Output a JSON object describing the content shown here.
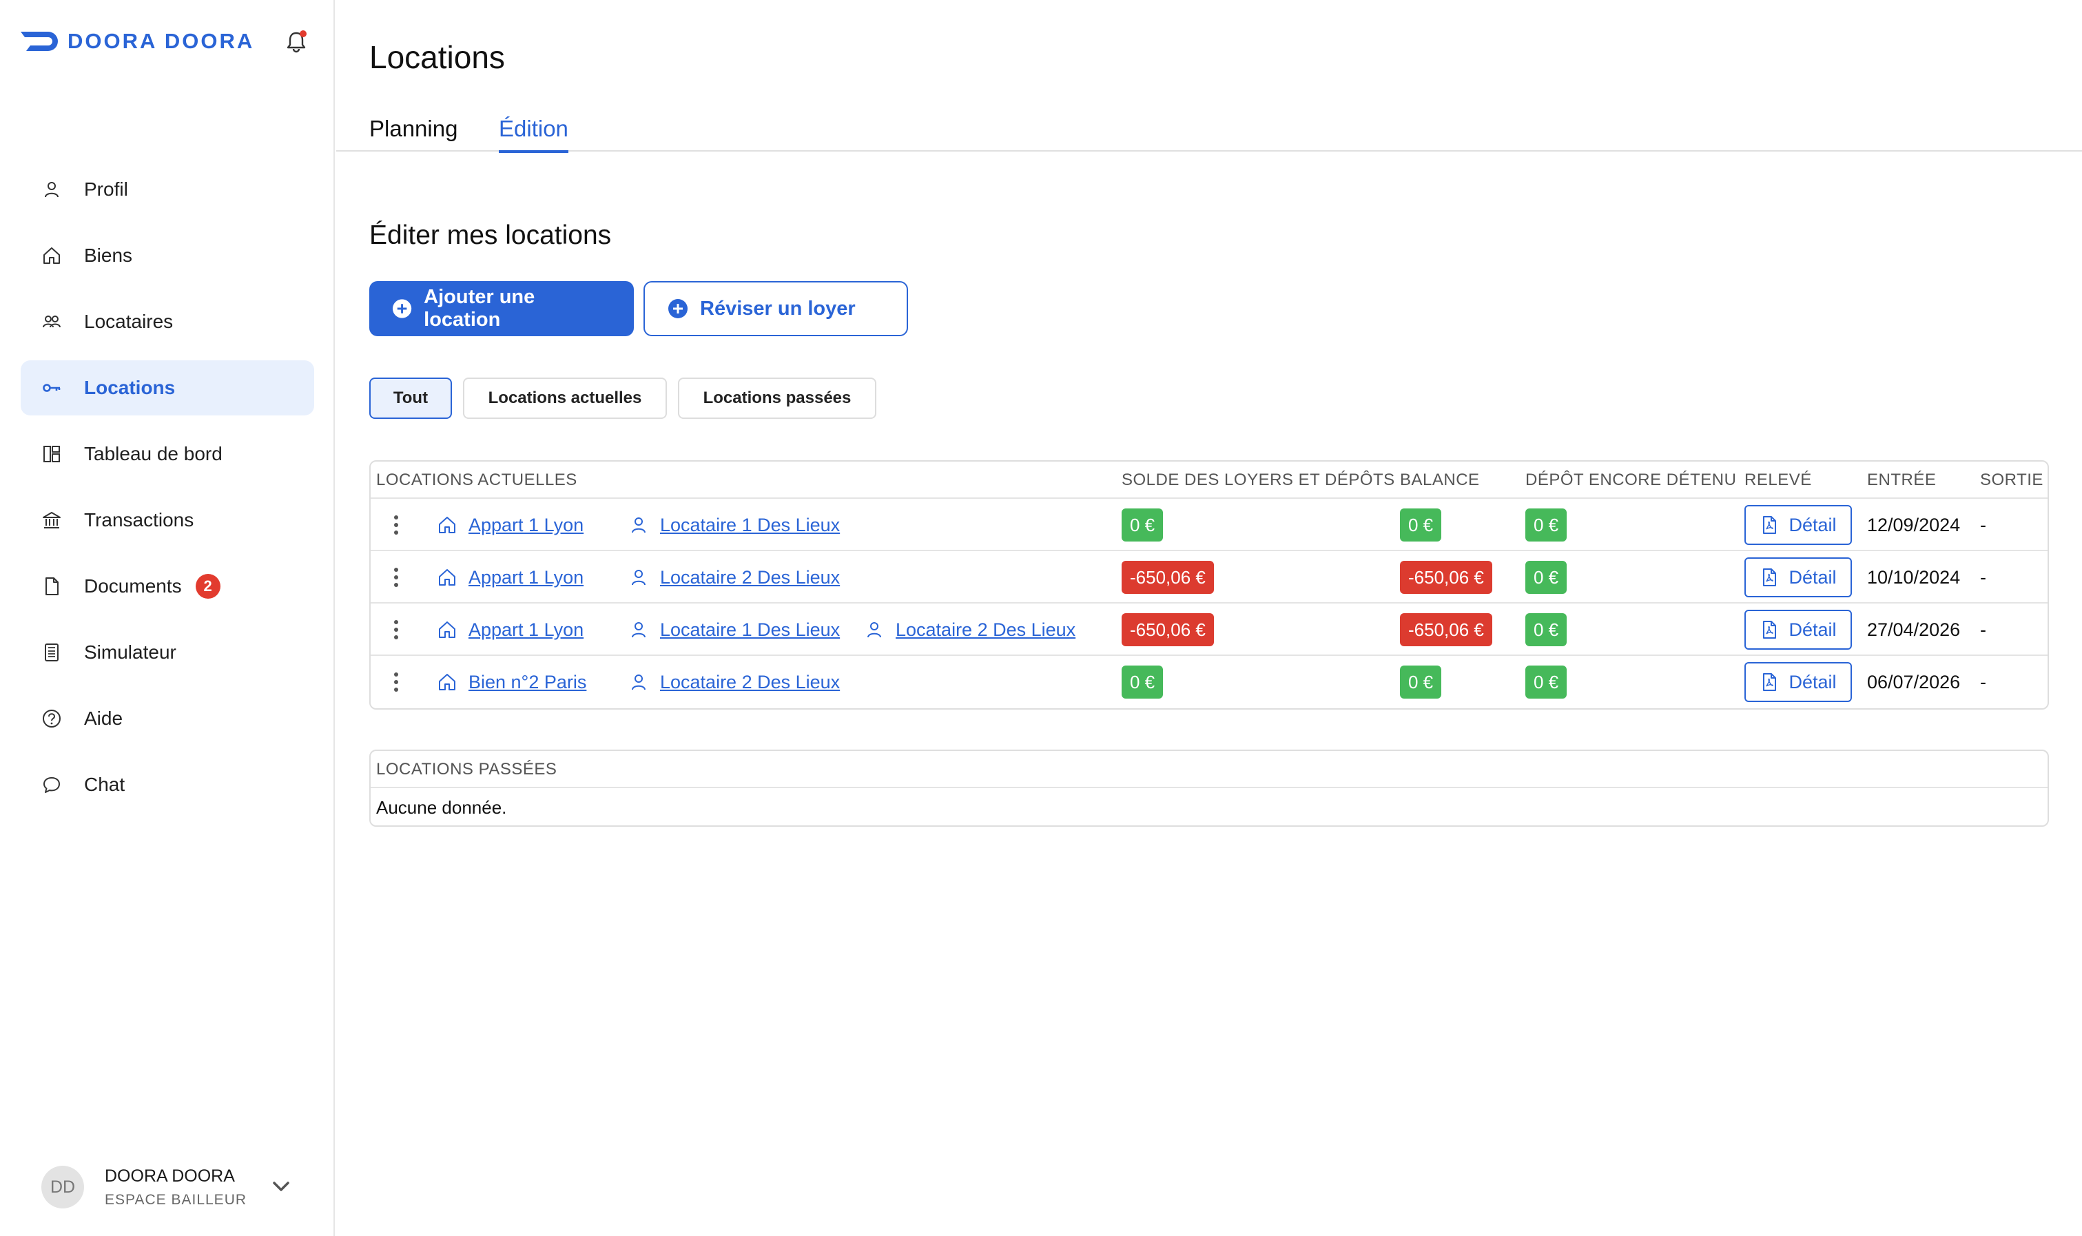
{
  "brand": {
    "name": "DOORA DOORA"
  },
  "sidebar": {
    "items": [
      {
        "label": "Profil",
        "icon": "user-icon"
      },
      {
        "label": "Biens",
        "icon": "home-icon"
      },
      {
        "label": "Locataires",
        "icon": "users-icon"
      },
      {
        "label": "Locations",
        "icon": "key-icon",
        "active": true
      },
      {
        "label": "Tableau de bord",
        "icon": "dashboard-icon"
      },
      {
        "label": "Transactions",
        "icon": "bank-icon"
      },
      {
        "label": "Documents",
        "icon": "document-icon",
        "badge": "2"
      },
      {
        "label": "Simulateur",
        "icon": "calculator-icon"
      },
      {
        "label": "Aide",
        "icon": "help-icon"
      },
      {
        "label": "Chat",
        "icon": "chat-icon"
      }
    ]
  },
  "user": {
    "initials": "DD",
    "name": "DOORA DOORA",
    "role": "ESPACE BAILLEUR"
  },
  "page": {
    "title": "Locations"
  },
  "tabs": [
    {
      "label": "Planning"
    },
    {
      "label": "Édition",
      "active": true
    }
  ],
  "section": {
    "title": "Éditer mes locations"
  },
  "actions": {
    "add_label": "Ajouter une location",
    "revise_label": "Réviser un loyer"
  },
  "filters": [
    {
      "label": "Tout",
      "active": true
    },
    {
      "label": "Locations actuelles"
    },
    {
      "label": "Locations passées"
    }
  ],
  "current_table": {
    "headers": {
      "locations": "LOCATIONS ACTUELLES",
      "solde": "SOLDE DES LOYERS ET DÉPÔTS",
      "balance": "BALANCE",
      "depot": "DÉPÔT ENCORE DÉTENU",
      "releve": "RELEVÉ",
      "entree": "ENTRÉE",
      "sortie": "SORTIE"
    },
    "rows": [
      {
        "bien": "Appart 1 Lyon",
        "tenants": [
          "Locataire 1 Des Lieux"
        ],
        "solde": "0 €",
        "solde_status": "green",
        "balance": "0 €",
        "balance_status": "green",
        "depot": "0 €",
        "releve": "Détail",
        "entree": "12/09/2024",
        "sortie": "-"
      },
      {
        "bien": "Appart 1 Lyon",
        "tenants": [
          "Locataire 2 Des Lieux"
        ],
        "solde": "-650,06 €",
        "solde_status": "red",
        "balance": "-650,06 €",
        "balance_status": "red",
        "depot": "0 €",
        "releve": "Détail",
        "entree": "10/10/2024",
        "sortie": "-"
      },
      {
        "bien": "Appart 1 Lyon",
        "tenants": [
          "Locataire 1 Des Lieux",
          "Locataire 2 Des Lieux"
        ],
        "solde": "-650,06 €",
        "solde_status": "red",
        "balance": "-650,06 €",
        "balance_status": "red",
        "depot": "0 €",
        "releve": "Détail",
        "entree": "27/04/2026",
        "sortie": "-"
      },
      {
        "bien": "Bien n°2 Paris",
        "tenants": [
          "Locataire 2 Des Lieux"
        ],
        "solde": "0 €",
        "solde_status": "green",
        "balance": "0 €",
        "balance_status": "green",
        "depot": "0 €",
        "releve": "Détail",
        "entree": "06/07/2026",
        "sortie": "-"
      }
    ]
  },
  "past_table": {
    "header": "LOCATIONS PASSÉES",
    "empty_text": "Aucune donnée."
  },
  "colors": {
    "accent": "#2a64d6",
    "positive": "#46b95a",
    "negative": "#dc3b2f",
    "active_bg": "#e8f0fd"
  }
}
